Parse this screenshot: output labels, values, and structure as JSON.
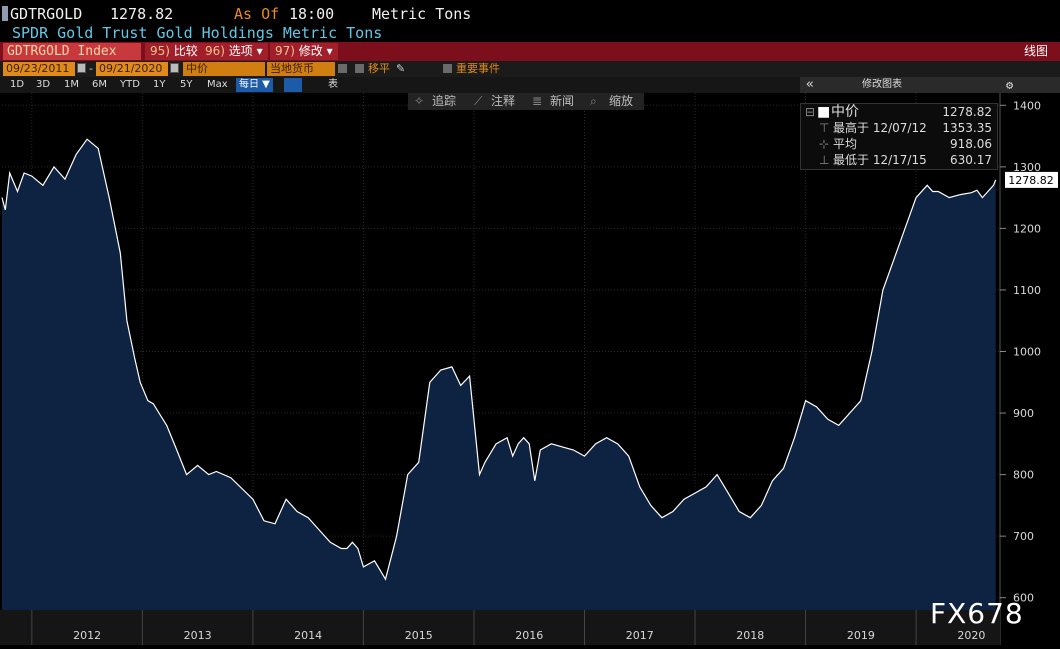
{
  "header": {
    "ticker": "GDTRGOLD",
    "last_value": "1278.82",
    "as_of_label": "As Of",
    "time": "18:00",
    "unit": "Metric Tons",
    "description": "SPDR Gold Trust Gold Holdings Metric Tons"
  },
  "menu_bar": {
    "security": "GDTRGOLD Index",
    "items": [
      {
        "num": "95)",
        "label": "比较"
      },
      {
        "num": "96)",
        "label": "选项"
      },
      {
        "num": "97)",
        "label": "修改"
      }
    ],
    "right_label": "线图"
  },
  "options_bar": {
    "start_date": "09/23/2011",
    "end_date": "09/21/2020",
    "dash": "-",
    "price_field": "中价",
    "currency_field": "当地货币",
    "move_label": "移平",
    "events_label": "重要事件"
  },
  "range_bar": {
    "ranges": [
      "1D",
      "3D",
      "1M",
      "6M",
      "YTD",
      "1Y",
      "5Y",
      "Max"
    ],
    "frequency": "每日 ▼",
    "table_label": "表",
    "panel_collapse": "«",
    "panel_edit": "修改图表",
    "panel_gear": "⚙"
  },
  "toolbar": {
    "items": [
      "追踪",
      "注释",
      "新闻",
      "缩放"
    ]
  },
  "legend": {
    "rows": [
      {
        "label": "中价",
        "value": "1278.82"
      },
      {
        "label": "最高于 12/07/12",
        "value": "1353.35"
      },
      {
        "label": "平均",
        "value": "918.06"
      },
      {
        "label": "最低于 12/17/15",
        "value": "630.17"
      }
    ]
  },
  "watermark": "FX678",
  "colors": {
    "background": "#000000",
    "area_fill": "#0e2342",
    "line": "#ffffff",
    "grid": "#2a2a2a",
    "menu_bar": "#7c0f1b",
    "subtitle": "#61c7e6",
    "options_field": "#e08a1c"
  },
  "chart_data": {
    "type": "area",
    "xlabel": "",
    "ylabel": "",
    "ylim": [
      580,
      1420
    ],
    "xlim": [
      2011.73,
      2020.75
    ],
    "yticks": [
      600,
      700,
      800,
      900,
      1000,
      1100,
      1200,
      1300,
      1400
    ],
    "xtick_labels": [
      "2012",
      "2013",
      "2014",
      "2015",
      "2016",
      "2017",
      "2018",
      "2019",
      "2020"
    ],
    "last_value_label": "1278.82",
    "series": [
      {
        "x": [
          2011.73,
          2011.76,
          2011.8,
          2011.87,
          2011.93,
          2012.0,
          2012.1,
          2012.2,
          2012.3,
          2012.4,
          2012.5,
          2012.6,
          2012.7,
          2012.8,
          2012.86,
          2012.93,
          2012.98,
          2013.05,
          2013.1,
          2013.15,
          2013.22,
          2013.3,
          2013.4,
          2013.5,
          2013.6,
          2013.67,
          2013.8,
          2014.0,
          2014.1,
          2014.2,
          2014.3,
          2014.4,
          2014.5,
          2014.6,
          2014.7,
          2014.8,
          2014.85,
          2014.9,
          2014.95,
          2015.0,
          2015.1,
          2015.2,
          2015.3,
          2015.4,
          2015.5,
          2015.6,
          2015.7,
          2015.8,
          2015.88,
          2015.96,
          2016.05,
          2016.1,
          2016.2,
          2016.3,
          2016.35,
          2016.4,
          2016.45,
          2016.5,
          2016.55,
          2016.6,
          2016.7,
          2016.8,
          2016.9,
          2017.0,
          2017.1,
          2017.2,
          2017.3,
          2017.4,
          2017.5,
          2017.6,
          2017.7,
          2017.8,
          2017.9,
          2018.0,
          2018.1,
          2018.2,
          2018.3,
          2018.4,
          2018.5,
          2018.6,
          2018.7,
          2018.8,
          2018.9,
          2019.0,
          2019.1,
          2019.2,
          2019.3,
          2019.35,
          2019.4,
          2019.5,
          2019.6,
          2019.7,
          2019.8,
          2019.9,
          2020.0,
          2020.1,
          2020.15,
          2020.2,
          2020.3,
          2020.4,
          2020.5,
          2020.55,
          2020.6,
          2020.65,
          2020.7,
          2020.72
        ],
        "values": [
          1250,
          1230,
          1290,
          1260,
          1290,
          1285,
          1270,
          1300,
          1280,
          1320,
          1345,
          1330,
          1250,
          1160,
          1050,
          990,
          950,
          920,
          915,
          900,
          880,
          845,
          800,
          815,
          800,
          805,
          795,
          760,
          725,
          720,
          760,
          740,
          730,
          710,
          690,
          680,
          680,
          690,
          680,
          650,
          660,
          630,
          700,
          800,
          820,
          950,
          970,
          975,
          945,
          960,
          800,
          820,
          850,
          860,
          830,
          850,
          860,
          850,
          790,
          840,
          850,
          845,
          840,
          830,
          850,
          860,
          850,
          830,
          780,
          750,
          730,
          740,
          760,
          770,
          780,
          800,
          770,
          740,
          730,
          750,
          790,
          810,
          860,
          920,
          910,
          890,
          880,
          890,
          900,
          920,
          1000,
          1100,
          1150,
          1200,
          1250,
          1270,
          1260,
          1260,
          1250,
          1255,
          1258,
          1262,
          1250,
          1260,
          1270,
          1278.82
        ]
      }
    ]
  }
}
